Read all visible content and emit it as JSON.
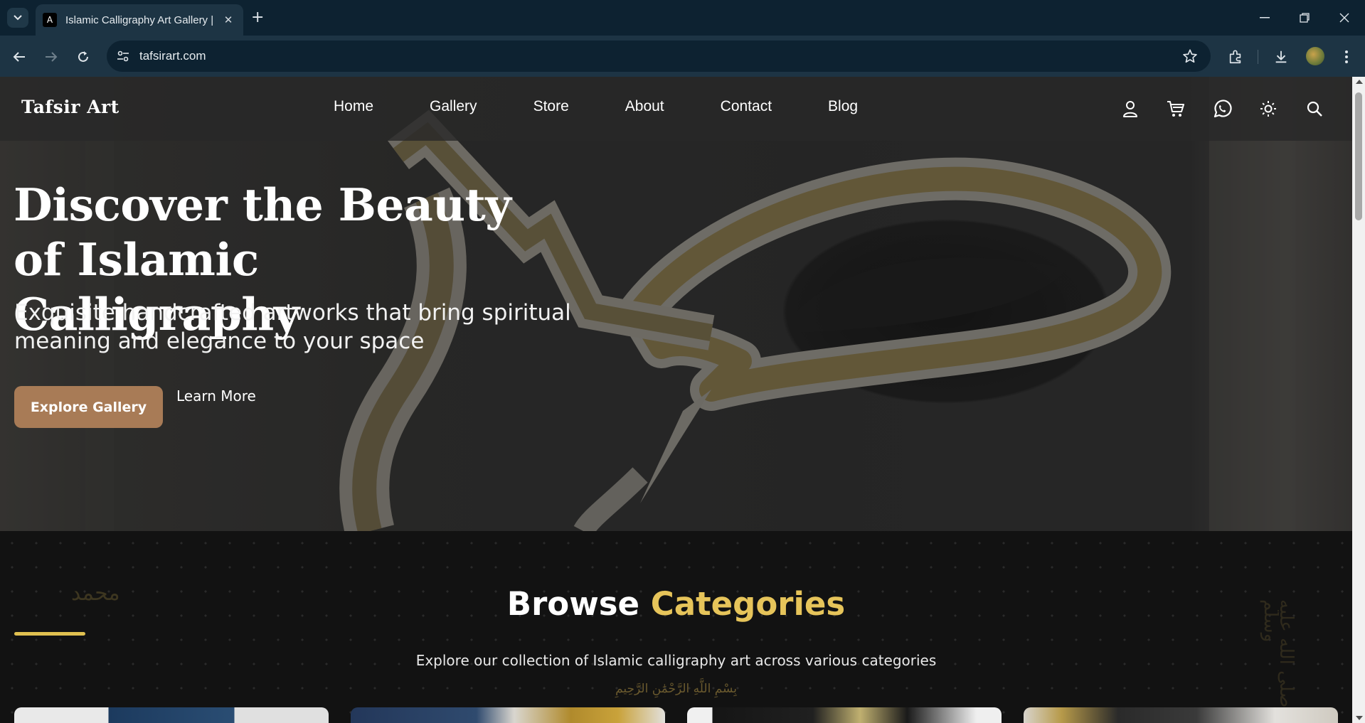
{
  "browser": {
    "tab_title": "Islamic Calligraphy Art Gallery |",
    "tab_favicon": "A",
    "new_tab_symbol": "+",
    "close_tab_symbol": "✕",
    "url": "tafsirart.com",
    "icons": [
      "tab-search-icon",
      "back-icon",
      "forward-icon",
      "reload-icon",
      "site-info-icon",
      "bookmark-star-icon",
      "extensions-icon",
      "download-icon",
      "profile-avatar",
      "more-menu-icon",
      "minimize-icon",
      "restore-icon",
      "close-window-icon"
    ]
  },
  "site": {
    "logo": "Tafsir Art",
    "nav": {
      "home": "Home",
      "gallery": "Gallery",
      "store": "Store",
      "about": "About",
      "contact": "Contact",
      "blog": "Blog"
    },
    "header_icons": [
      "user-icon",
      "cart-icon",
      "whatsapp-icon",
      "theme-toggle-sun-icon",
      "search-icon"
    ]
  },
  "hero": {
    "title": "Discover the Beauty of Islamic Calligraphy",
    "subtitle": "Exquisite handcrafted artworks that bring spiritual meaning and elegance to your space",
    "primary_button": "Explore Gallery",
    "secondary_button": "Learn More",
    "accent_color": "#a87b56"
  },
  "categories": {
    "title_main": "Browse ",
    "title_accent": "Categories",
    "subtitle": "Explore our collection of Islamic calligraphy art across various categories",
    "bismillah": "بِسْمِ اللَّهِ الرَّحْمَٰنِ الرَّحِيمِ",
    "deco_left": "محمد",
    "deco_right": "صلى الله عليه وسلم",
    "accent_color": "#e6c45a"
  }
}
